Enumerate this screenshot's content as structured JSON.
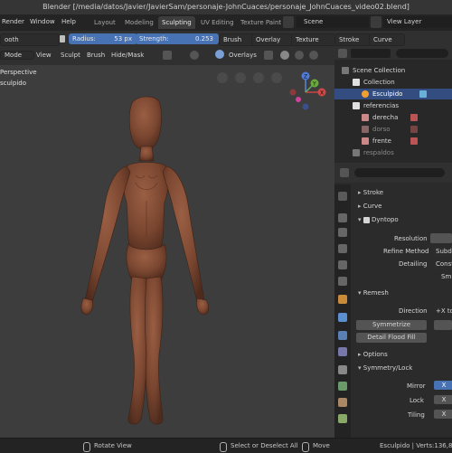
{
  "window": {
    "title": "Blender [/media/datos/Javier/JavierSam/personaje-JohnCuaces/personaje_JohnCuaces_video02.blend]"
  },
  "topbar": {
    "menus": [
      "Render",
      "Window",
      "Help"
    ],
    "tabs": [
      "Layout",
      "Modeling",
      "Sculpting",
      "UV Editing",
      "Texture Paint"
    ],
    "scene_label": "Scene",
    "view_layer": "View Layer"
  },
  "tool_header": {
    "brush_name": "ooth",
    "radius_label": "Radius:",
    "radius_value": "53 px",
    "strength_label": "Strength:",
    "strength_value": "0.253",
    "menus": [
      "Brush",
      "Overlay",
      "Texture",
      "Stroke",
      "Curve"
    ]
  },
  "viewport_header": {
    "mode": "Mode",
    "menus": [
      "View",
      "Sculpt",
      "Brush",
      "Hide/Mask"
    ],
    "overlays": "Overlays"
  },
  "viewport": {
    "view_name": "Perspective",
    "object_name": "sculpido"
  },
  "gizmo": {
    "x": "X",
    "y": "Y",
    "z": "Z"
  },
  "outliner": {
    "items": [
      "Scene Collection",
      "Collection",
      "Esculpido",
      "referencias",
      "derecha",
      "dorso",
      "frente",
      "respaldos"
    ]
  },
  "properties": {
    "sections": {
      "stroke": "Stroke",
      "curve": "Curve",
      "dyntopo": "Dyntopo",
      "remesh": "Remesh",
      "options": "Options",
      "symmetry": "Symmetry/Lock"
    },
    "resolution": "Resolution",
    "refine_method": "Refine Method",
    "refine_value": "Subdi",
    "detailing": "Detailing",
    "detailing_value": "Const",
    "sm": "Sm",
    "direction": "Direction",
    "direction_value": "+X to",
    "symmetrize": "Symmetrize",
    "detail_flood_fill": "Detail Flood Fill",
    "mirror": "Mirror",
    "lock": "Lock",
    "tiling": "Tiling",
    "x": "X"
  },
  "statusbar": {
    "left": "Rotate View",
    "middle": "Select or Deselect All",
    "move": "Move",
    "stats": "Esculpido | Verts:136,877 |"
  },
  "colors": {
    "accent": "#4772b3",
    "active_tab": "#3d3d3d",
    "viewport_bg": "#3d3d3d",
    "skin": "#7e4a33"
  }
}
